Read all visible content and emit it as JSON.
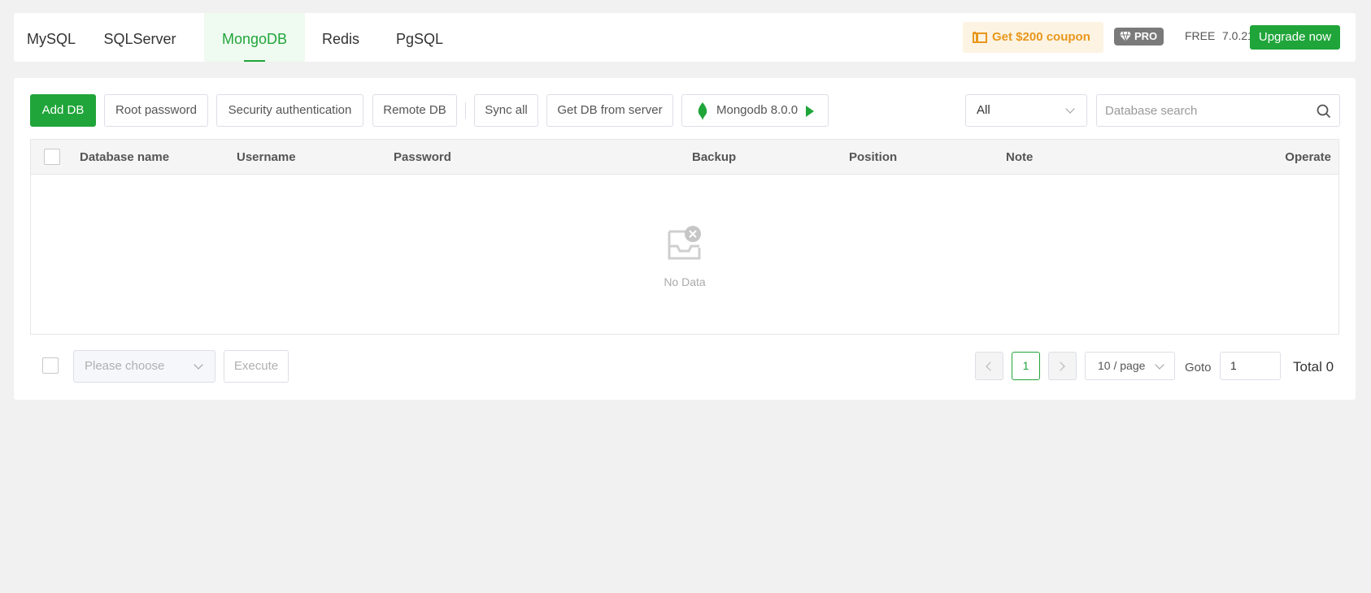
{
  "tabs": [
    {
      "label": "MySQL",
      "active": false
    },
    {
      "label": "SQLServer",
      "active": false
    },
    {
      "label": "MongoDB",
      "active": true
    },
    {
      "label": "Redis",
      "active": false
    },
    {
      "label": "PgSQL",
      "active": false
    }
  ],
  "header": {
    "coupon_label": "Get $200 coupon",
    "pro_label": "PRO",
    "plan_label": "FREE",
    "version": "7.0.21",
    "upgrade_label": "Upgrade now"
  },
  "toolbar": {
    "add_db": "Add DB",
    "root_password": "Root password",
    "security_auth": "Security authentication",
    "remote_db": "Remote DB",
    "sync_all": "Sync all",
    "get_from_server": "Get DB from server",
    "mongo_version": "Mongodb 8.0.0",
    "filter_value": "All",
    "search_placeholder": "Database search"
  },
  "table": {
    "columns": [
      "Database name",
      "Username",
      "Password",
      "Backup",
      "Position",
      "Note",
      "Operate"
    ],
    "rows": [],
    "empty_text": "No Data"
  },
  "footer": {
    "batch_placeholder": "Please choose",
    "execute_label": "Execute",
    "current_page": "1",
    "per_page": "10 / page",
    "goto_label": "Goto",
    "goto_value": "1",
    "total_label": "Total 0"
  },
  "colors": {
    "accent": "#20a53a",
    "coupon": "#e8971c",
    "coupon_bg": "#fdf3e2",
    "page_bg": "#f1f1f1"
  },
  "icons": [
    "coupon-icon",
    "diamond-icon",
    "mongodb-leaf-icon",
    "play-icon",
    "chevron-down-icon",
    "search-icon",
    "empty-inbox-icon",
    "chevron-left-icon",
    "chevron-right-icon"
  ]
}
